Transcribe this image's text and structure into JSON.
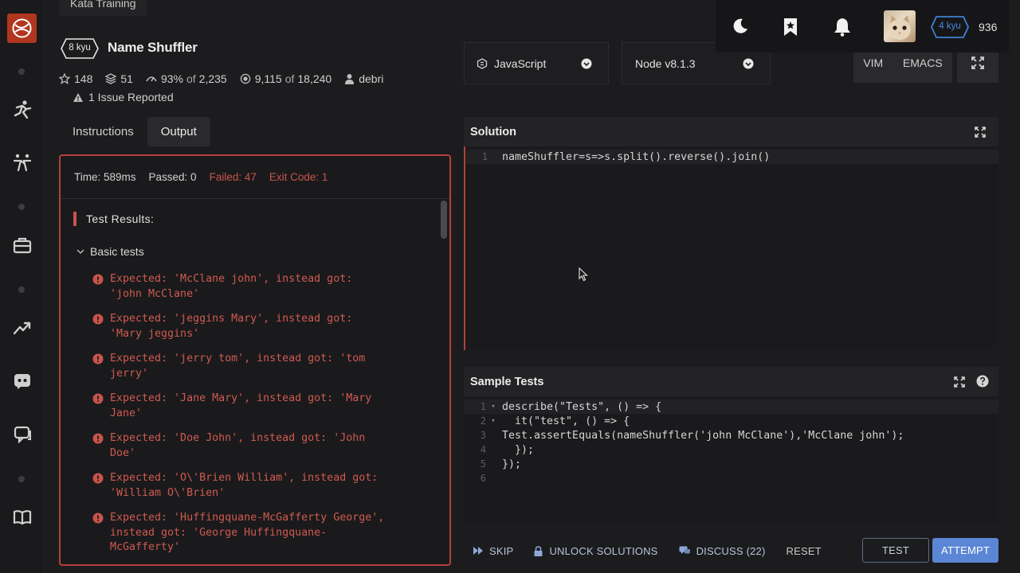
{
  "header": {
    "breadcrumb": "Kata Training",
    "kyu_label": "8 kyu",
    "title": "Name Shuffler",
    "stats": {
      "stars": "148",
      "collections": "51",
      "satisfaction": "93%",
      "satisfaction_of": "of",
      "satisfaction_votes": "2,235",
      "completed": "9,115",
      "completed_of": "of",
      "attempted": "18,240",
      "author": "debri"
    },
    "issues": "1 Issue Reported"
  },
  "tabs": [
    {
      "label": "Instructions",
      "active": false
    },
    {
      "label": "Output",
      "active": true
    }
  ],
  "output": {
    "time": "Time: 589ms",
    "passed": "Passed: 0",
    "failed": "Failed: 47",
    "exit_code": "Exit Code: 1",
    "results_title": "Test Results:",
    "group": "Basic tests",
    "failures": [
      "Expected: 'McClane john', instead got:\n'john McClane'",
      "Expected: 'jeggins Mary', instead got:\n'Mary jeggins'",
      "Expected: 'jerry tom', instead got: 'tom\njerry'",
      "Expected: 'Jane Mary', instead got: 'Mary\nJane'",
      "Expected: 'Doe John', instead got: 'John\nDoe'",
      "Expected: 'O\\'Brien William', instead got:\n'William O\\'Brien'",
      "Expected: 'Huffingquane-McGafferty George',\ninstead got: 'George Huffingquane-\nMcGafferty'"
    ]
  },
  "language": {
    "selected": "JavaScript"
  },
  "runtime": {
    "selected": "Node v8.1.3"
  },
  "modes": {
    "vim": "VIM",
    "emacs": "EMACS"
  },
  "user": {
    "rank": "4 kyu",
    "honor": "936"
  },
  "solution": {
    "title": "Solution",
    "lines": [
      {
        "n": "1",
        "code": "nameShuffler=s=>s.split().reverse().join()"
      }
    ]
  },
  "sample_tests": {
    "title": "Sample Tests",
    "lines": [
      {
        "n": "1",
        "fold": "▾",
        "code": "describe(\"Tests\", () => {"
      },
      {
        "n": "2",
        "fold": "▾",
        "code": "  it(\"test\", () => {"
      },
      {
        "n": "3",
        "fold": "",
        "code": "Test.assertEquals(nameShuffler('john McClane'),'McClane john');"
      },
      {
        "n": "4",
        "fold": "",
        "code": "  });"
      },
      {
        "n": "5",
        "fold": "",
        "code": "});"
      },
      {
        "n": "6",
        "fold": "",
        "code": ""
      }
    ]
  },
  "actions": {
    "skip": "SKIP",
    "unlock": "UNLOCK SOLUTIONS",
    "discuss": "DISCUSS (22)",
    "reset": "RESET",
    "test": "TEST",
    "attempt": "ATTEMPT"
  },
  "colors": {
    "accent_red": "#b4403a",
    "fail_text": "#cf5a50",
    "attempt_blue": "#5b86d6",
    "rank_blue": "#3f7fd4",
    "logo_red": "#b1361e"
  },
  "icons": [
    "codewars-logo-icon",
    "training-icon",
    "dojo-icon",
    "briefcase-icon",
    "leaderboard-icon",
    "discord-icon",
    "chat-icon",
    "book-icon",
    "moon-icon",
    "bookmark-icon",
    "bell-icon",
    "star-icon",
    "collection-icon",
    "satisfaction-icon",
    "completed-icon",
    "user-icon",
    "warning-icon",
    "chevron-down-icon",
    "error-icon",
    "expand-icon",
    "help-icon",
    "skip-icon",
    "lock-icon",
    "discuss-icon",
    "javascript-icon"
  ]
}
